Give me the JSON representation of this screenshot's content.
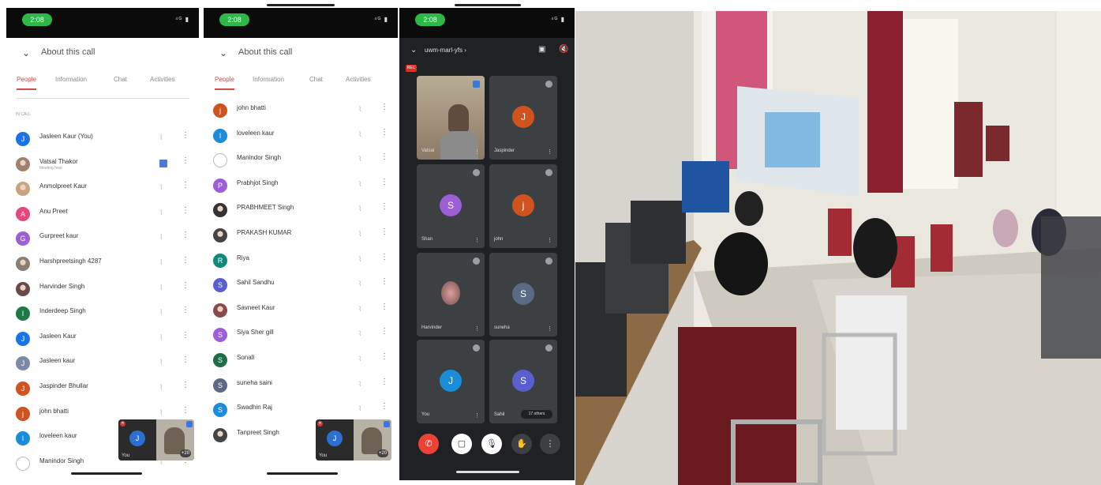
{
  "phone1": {
    "status_time": "2:08",
    "status_signal": "⁴ᴳ ▮",
    "header": {
      "chevron": "⌄",
      "title": "About this call"
    },
    "tabs": [
      "People",
      "Information",
      "Chat",
      "Activities"
    ],
    "section_label": "IN CALL",
    "participants": [
      {
        "name": "Jasleen Kaur (You)",
        "initial": "J",
        "color": "#1a73e8",
        "subtitle": ""
      },
      {
        "name": "Vatsal Thakor",
        "initial": "",
        "color": "#a08070",
        "subtitle": "Meeting host",
        "photo": true
      },
      {
        "name": "Anmolpreet Kaur",
        "initial": "",
        "color": "#c9a27e",
        "subtitle": "",
        "photo": true
      },
      {
        "name": "Anu Preet",
        "initial": "A",
        "color": "#e8467c",
        "subtitle": ""
      },
      {
        "name": "Gurpreet kaur",
        "initial": "G",
        "color": "#9c5fd6",
        "subtitle": ""
      },
      {
        "name": "Harshpreetsingh 4287",
        "initial": "",
        "color": "#8a7f75",
        "subtitle": "",
        "photo": true
      },
      {
        "name": "Harvinder Singh",
        "initial": "",
        "color": "#6a4a4a",
        "subtitle": "",
        "photo": true
      },
      {
        "name": "Inderdeep Singh",
        "initial": "I",
        "color": "#1e7a45",
        "subtitle": ""
      },
      {
        "name": "Jasleen Kaur",
        "initial": "J",
        "color": "#1a73e8",
        "subtitle": ""
      },
      {
        "name": "Jasleen kaur",
        "initial": "J",
        "color": "#7a8aa8",
        "subtitle": ""
      },
      {
        "name": "Jaspinder Bhullar",
        "initial": "J",
        "color": "#d0531f",
        "subtitle": ""
      },
      {
        "name": "john bhatti",
        "initial": "j",
        "color": "#d0531f",
        "subtitle": ""
      },
      {
        "name": "loveleen kaur",
        "initial": "l",
        "color": "#1a8cd8",
        "subtitle": ""
      },
      {
        "name": "Manindor Singh",
        "initial": "",
        "color": "#dddddd",
        "subtitle": ""
      }
    ],
    "pip": {
      "you_label": "You",
      "count": "+20"
    }
  },
  "phone2": {
    "status_time": "2:08",
    "status_signal": "⁴ᴳ ▮",
    "header": {
      "chevron": "⌄",
      "title": "About this call"
    },
    "tabs": [
      "People",
      "Information",
      "Chat",
      "Activities"
    ],
    "participants": [
      {
        "name": "john bhatti",
        "initial": "j",
        "color": "#d0531f"
      },
      {
        "name": "loveleen kaur",
        "initial": "l",
        "color": "#1a8cd8"
      },
      {
        "name": "Manindor Singh",
        "initial": "",
        "color": "#dddddd"
      },
      {
        "name": "Prabhjot Singh",
        "initial": "P",
        "color": "#9c5fd6"
      },
      {
        "name": "PRABHMEET Singh",
        "initial": "",
        "color": "#333333",
        "photo": true
      },
      {
        "name": "PRAKASH KUMAR",
        "initial": "",
        "color": "#444444",
        "photo": true
      },
      {
        "name": "Riya",
        "initial": "R",
        "color": "#0f8a7a"
      },
      {
        "name": "Sahil Sandhu",
        "initial": "S",
        "color": "#5a5fd0"
      },
      {
        "name": "Savneet Kaur",
        "initial": "",
        "color": "#8a4a4a",
        "photo": true
      },
      {
        "name": "Siya Sher gill",
        "initial": "S",
        "color": "#9c5fd6"
      },
      {
        "name": "Sonali",
        "initial": "S",
        "color": "#1e6e45"
      },
      {
        "name": "suneha saini",
        "initial": "S",
        "color": "#5a6a85"
      },
      {
        "name": "Swadhin Raj",
        "initial": "S",
        "color": "#1a8cd8"
      },
      {
        "name": "Tanpreet Singh",
        "initial": "",
        "color": "#444444",
        "photo": true
      }
    ],
    "pip": {
      "you_label": "You",
      "count": "+20"
    }
  },
  "phone3": {
    "status_time": "2:08",
    "status_signal": "⁴ᴳ ▮",
    "meeting_code": "uwm-marl-yfs ›",
    "rec_label": "REC",
    "tiles": [
      {
        "name": "Vatsal",
        "type": "photo"
      },
      {
        "name": "Jaspinder",
        "initial": "J",
        "color": "#d0531f"
      },
      {
        "name": "Shan",
        "initial": "S",
        "color": "#9c5fd6"
      },
      {
        "name": "john",
        "initial": "j",
        "color": "#d0531f"
      },
      {
        "name": "Harvinder",
        "type": "round-photo"
      },
      {
        "name": "suneha",
        "initial": "S",
        "color": "#5a6a85"
      },
      {
        "name": "You",
        "initial": "J",
        "color": "#1a8cd8"
      },
      {
        "name": "Sahil",
        "initial": "S",
        "color": "#5a5fd0",
        "others": "17 others"
      }
    ],
    "controls": [
      "end-call",
      "camera",
      "mic",
      "hand",
      "more"
    ]
  },
  "photo": {
    "description_alt": ""
  }
}
